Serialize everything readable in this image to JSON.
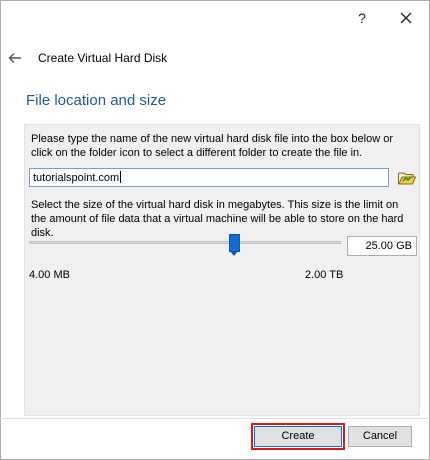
{
  "window": {
    "help_label": "?",
    "title": "Create Virtual Hard Disk"
  },
  "section": {
    "title": "File location and size"
  },
  "file": {
    "description": "Please type the name of the new virtual hard disk file into the box below or click on the folder icon to select a different folder to create the file in.",
    "value": "tutorialspoint.com",
    "folder_icon": "folder-open-icon"
  },
  "size": {
    "description": "Select the size of the virtual hard disk in megabytes. This size is the limit on the amount of file data that a virtual machine will be able to store on the hard disk.",
    "value": "25.00 GB",
    "slider_fraction": 0.656,
    "min_label": "4.00 MB",
    "max_label": "2.00 TB"
  },
  "buttons": {
    "create": "Create",
    "cancel": "Cancel"
  },
  "colors": {
    "accent": "#1c5d99",
    "slider_thumb": "#0f6fd1",
    "highlight": "#e0161c"
  }
}
